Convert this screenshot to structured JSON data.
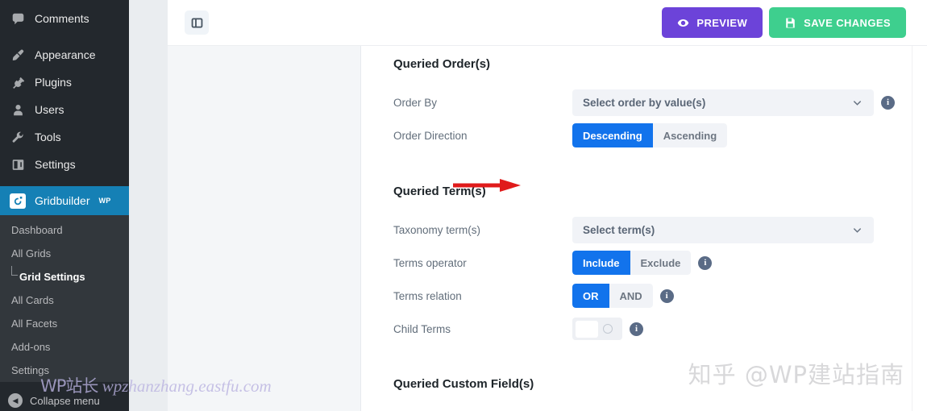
{
  "wp_sidebar": {
    "items": [
      {
        "label": "Comments",
        "icon": "comment-icon"
      },
      {
        "label": "Appearance",
        "icon": "paintbrush-icon"
      },
      {
        "label": "Plugins",
        "icon": "plug-icon"
      },
      {
        "label": "Users",
        "icon": "user-icon"
      },
      {
        "label": "Tools",
        "icon": "wrench-icon"
      },
      {
        "label": "Settings",
        "icon": "sliders-icon"
      }
    ],
    "active_item": {
      "label": "Gridbuilder",
      "sup": "WP",
      "icon": "gridbuilder-icon"
    },
    "submenu": [
      {
        "label": "Dashboard",
        "current": false
      },
      {
        "label": "All Grids",
        "current": false
      },
      {
        "label": "Grid Settings",
        "current": true
      },
      {
        "label": "All Cards",
        "current": false
      },
      {
        "label": "All Facets",
        "current": false
      },
      {
        "label": "Add-ons",
        "current": false
      },
      {
        "label": "Settings",
        "current": false
      }
    ],
    "collapse_label": "Collapse menu"
  },
  "topbar": {
    "panel_toggle_icon": "panel-left-toggle-icon",
    "preview_label": "PREVIEW",
    "preview_icon": "eye-icon",
    "preview_color": "#6c43d9",
    "save_label": "SAVE CHANGES",
    "save_icon": "floppy-disk-icon",
    "save_color": "#3ecf8e"
  },
  "form": {
    "sections": [
      {
        "title": "Queried Order(s)",
        "rows": [
          {
            "label": "Order By",
            "control": "select",
            "value": "Select order by value(s)",
            "has_info": true
          },
          {
            "label": "Order Direction",
            "control": "segmented",
            "options": [
              "Descending",
              "Ascending"
            ],
            "selected": "Descending",
            "has_info": false
          }
        ]
      },
      {
        "title": "Queried Term(s)",
        "rows": [
          {
            "label": "Taxonomy term(s)",
            "control": "select",
            "value": "Select term(s)",
            "has_info": false
          },
          {
            "label": "Terms operator",
            "control": "segmented",
            "options": [
              "Include",
              "Exclude"
            ],
            "selected": "Include",
            "has_info": true
          },
          {
            "label": "Terms relation",
            "control": "segmented",
            "options": [
              "OR",
              "AND"
            ],
            "selected": "OR",
            "has_info": true
          },
          {
            "label": "Child Terms",
            "control": "toggle",
            "checked": false,
            "has_info": true
          }
        ]
      },
      {
        "title": "Queried Custom Field(s)",
        "rows": []
      }
    ],
    "accent_color": "#1273ec"
  },
  "annotations": {
    "arrow_color": "#e01b1b",
    "watermark_left": "WP站长  wpzhanzhang.eastfu.com",
    "watermark_left_cn": "WP站长",
    "watermark_left_url": "wpzhanzhang.eastfu.com",
    "watermark_right": "知乎 @WP建站指南"
  }
}
